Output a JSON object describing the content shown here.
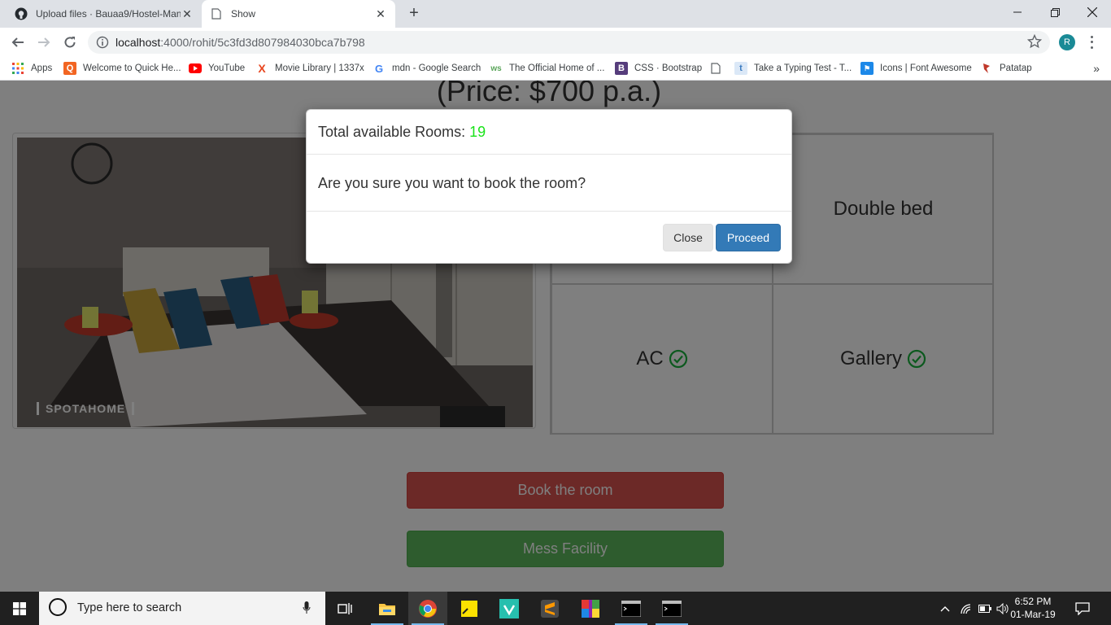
{
  "browser": {
    "tabs": [
      {
        "title": "Upload files · Bauaa9/Hostel-Manag",
        "active": false
      },
      {
        "title": "Show",
        "active": true
      }
    ],
    "url_host": "localhost",
    "url_path": ":4000/rohit/5c3fd3d807984030bca7b798",
    "profile_initial": "R",
    "bookmarks": [
      {
        "label": "Apps",
        "icon": "apps-grid-icon"
      },
      {
        "label": "Welcome to Quick He...",
        "icon": "quick-heal-icon"
      },
      {
        "label": "YouTube",
        "icon": "youtube-icon"
      },
      {
        "label": "Movie Library | 1337x",
        "icon": "1337x-icon"
      },
      {
        "label": "mdn - Google Search",
        "icon": "google-icon"
      },
      {
        "label": "The Official Home of ...",
        "icon": "official-home-icon"
      },
      {
        "label": "CSS · Bootstrap",
        "icon": "bootstrap-icon"
      },
      {
        "label": "",
        "icon": "page-icon"
      },
      {
        "label": "Take a Typing Test - T...",
        "icon": "typing-test-icon"
      },
      {
        "label": "Icons | Font Awesome",
        "icon": "font-awesome-icon"
      },
      {
        "label": "Patatap",
        "icon": "patatap-icon"
      }
    ]
  },
  "page": {
    "price": "(Price: $700 p.a.)",
    "photo_watermark": "SPOTAHOME",
    "features": [
      {
        "label": "",
        "check": false
      },
      {
        "label": "Double bed",
        "check": false
      },
      {
        "label": "AC",
        "check": true
      },
      {
        "label": "Gallery",
        "check": true
      }
    ],
    "book_button": "Book the room",
    "mess_button": "Mess Facility"
  },
  "modal": {
    "title_prefix": "Total available Rooms:",
    "room_count": "19",
    "body_text": "Are you sure you want to book the room?",
    "close_label": "Close",
    "proceed_label": "Proceed"
  },
  "taskbar": {
    "search_placeholder": "Type here to search",
    "time": "6:52 PM",
    "date": "01-Mar-19"
  },
  "colors": {
    "count_green": "#19e319",
    "proceed_blue": "#337ab7",
    "danger_red": "#d9534f",
    "success_green": "#5cb85c",
    "check_green": "#18b23c"
  }
}
